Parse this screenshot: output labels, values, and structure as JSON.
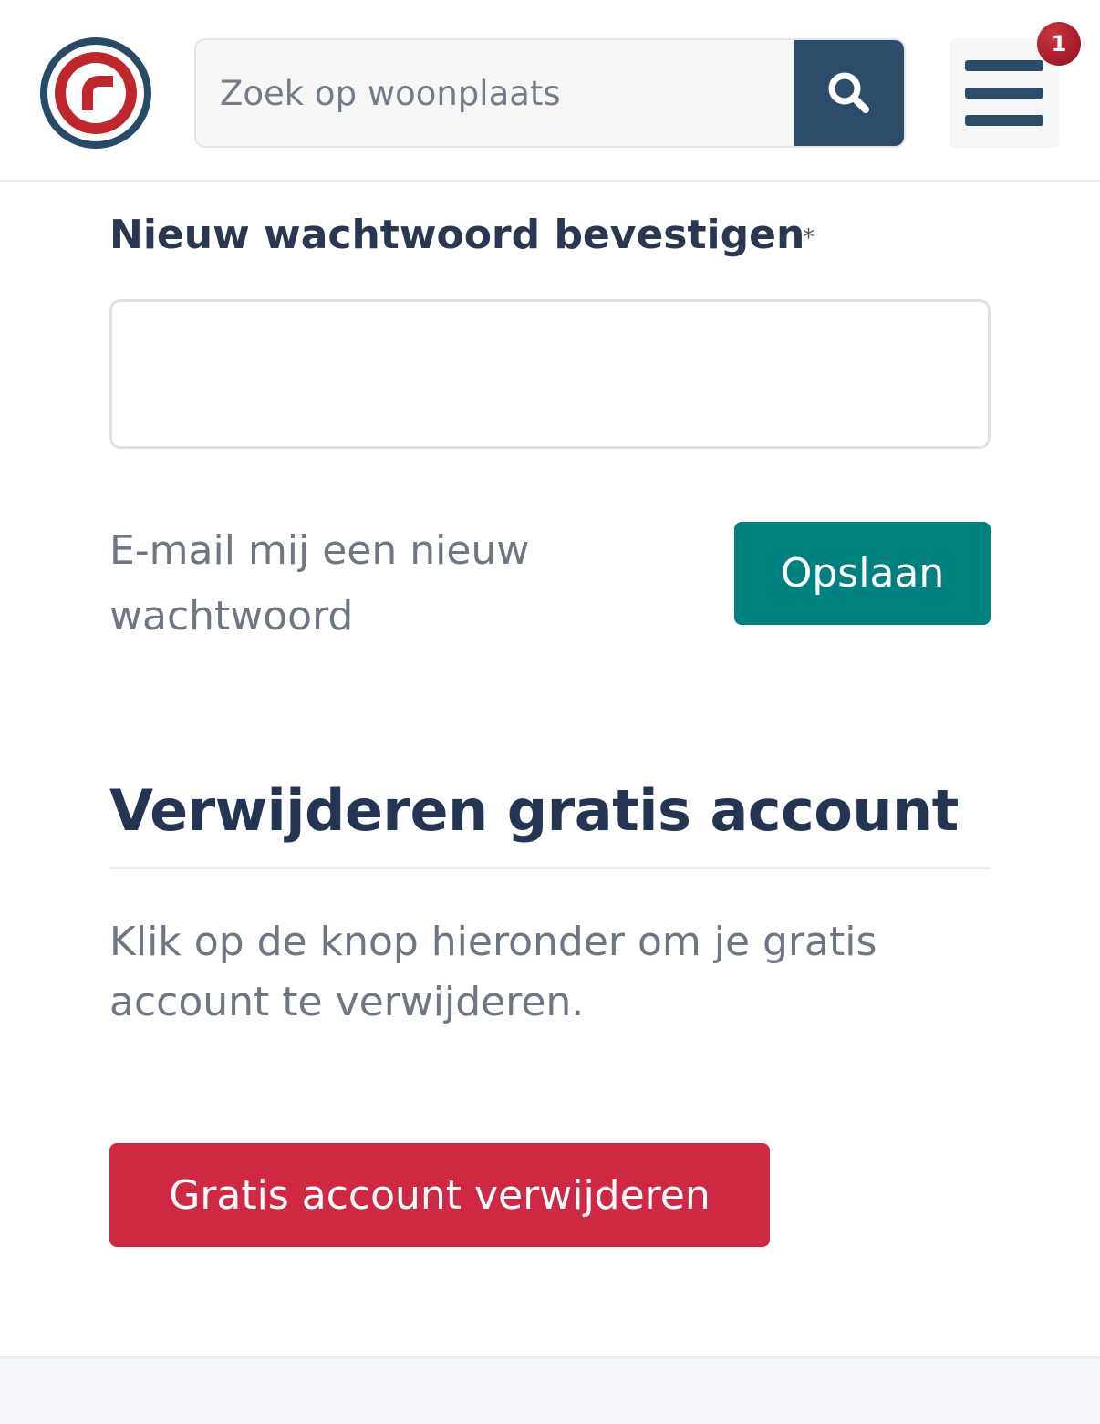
{
  "header": {
    "search_placeholder": "Zoek op woonplaats",
    "search_icon": "search-icon",
    "menu_icon": "hamburger-menu-icon",
    "notification_count": "1"
  },
  "form": {
    "confirm_password_label": "Nieuw wachtwoord bevestigen",
    "required_marker": "*",
    "confirm_password_value": "",
    "email_new_password_link": "E-mail mij een nieuw wachtwoord",
    "save_button": "Opslaan"
  },
  "delete_section": {
    "title": "Verwijderen gratis account",
    "description": "Klik op de knop hieronder om je gratis account te verwijderen.",
    "delete_button": "Gratis account verwijderen"
  },
  "colors": {
    "navy": "#2c4c6a",
    "teal": "#00807e",
    "danger": "#cf2842",
    "badge": "#a91e2a"
  }
}
